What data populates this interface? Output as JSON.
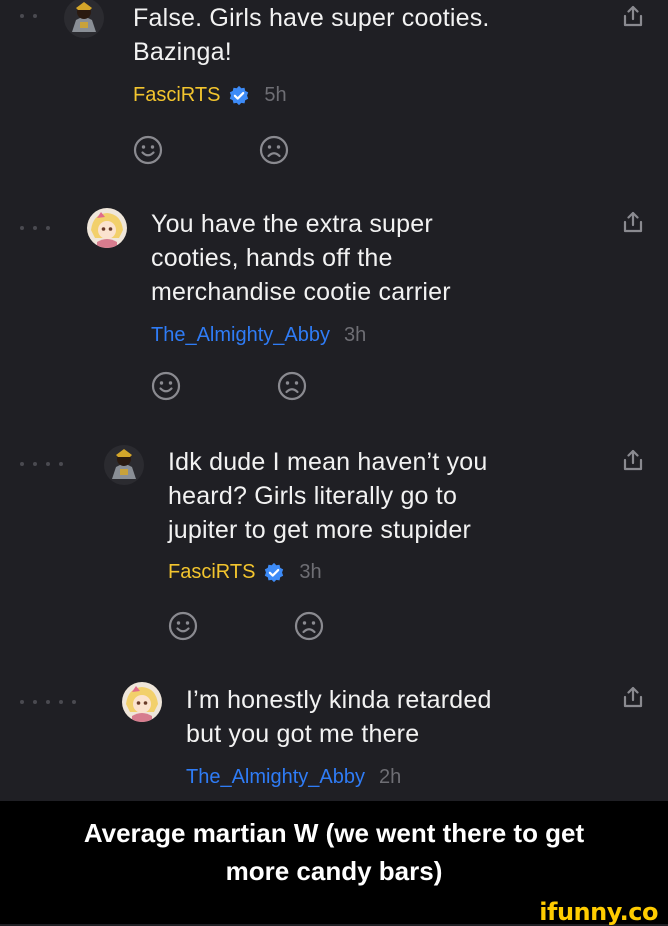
{
  "comments": [
    {
      "text": "False. Girls have super cooties.\nBazinga!",
      "username": "FasciRTS",
      "username_color": "#f3c52e",
      "verified": true,
      "time": "5h",
      "avatar_icon": "knight-avatar-icon"
    },
    {
      "text": "You have the extra super\ncooties, hands off the\nmerchandise cootie carrier",
      "username": "The_Almighty_Abby",
      "username_color": "#2f7cf6",
      "verified": false,
      "time": "3h",
      "avatar_icon": "anime-girl-avatar-icon"
    },
    {
      "text": "Idk dude I mean haven’t you\nheard? Girls literally go to\njupiter to get more stupider",
      "username": "FasciRTS",
      "username_color": "#f3c52e",
      "verified": true,
      "time": "3h",
      "avatar_icon": "knight-avatar-icon"
    },
    {
      "text": "I’m honestly kinda retarded\nbut you got me there",
      "username": "The_Almighty_Abby",
      "username_color": "#2f7cf6",
      "verified": false,
      "time": "2h",
      "avatar_icon": "anime-girl-avatar-icon"
    }
  ],
  "caption": "Average martian W (we went there to get\nmore candy bars)",
  "watermark": "ifunny.co",
  "colors": {
    "background": "#1f1f24",
    "caption_bg": "#000000",
    "watermark": "#ffcc00",
    "verified": "#3d8bf7",
    "muted": "#6e6e74"
  }
}
